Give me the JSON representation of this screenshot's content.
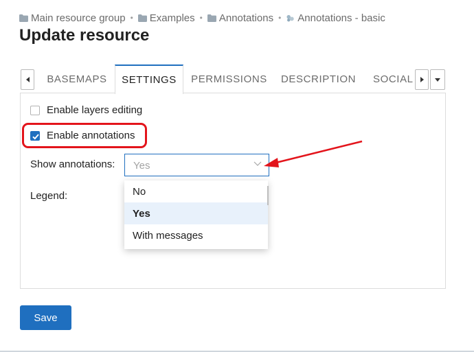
{
  "breadcrumb": [
    {
      "label": "Main resource group",
      "icon": "folder-icon"
    },
    {
      "label": "Examples",
      "icon": "folder-icon"
    },
    {
      "label": "Annotations",
      "icon": "folder-icon"
    },
    {
      "label": "Annotations - basic",
      "icon": "webmap-icon"
    }
  ],
  "breadcrumb_separator": "•",
  "page": {
    "title": "Update resource"
  },
  "tabs": [
    {
      "label": "BASEMAPS",
      "active": false
    },
    {
      "label": "SETTINGS",
      "active": true
    },
    {
      "label": "PERMISSIONS",
      "active": false
    },
    {
      "label": "DESCRIPTION",
      "active": false
    },
    {
      "label": "SOCIAL",
      "active": false
    }
  ],
  "settings": {
    "layers_editing": {
      "label": "Enable layers editing",
      "checked": false
    },
    "annotations": {
      "label": "Enable annotations",
      "checked": true
    },
    "show_annotations": {
      "label": "Show annotations:",
      "value": "Yes",
      "options": [
        {
          "label": "No",
          "selected": false
        },
        {
          "label": "Yes",
          "selected": true
        },
        {
          "label": "With messages",
          "selected": false
        }
      ]
    },
    "legend": {
      "label": "Legend:"
    }
  },
  "actions": {
    "save_label": "Save"
  },
  "colors": {
    "accent": "#1f6fbf",
    "highlight": "#e3141b",
    "selected_option_bg": "#e8f1fb"
  }
}
